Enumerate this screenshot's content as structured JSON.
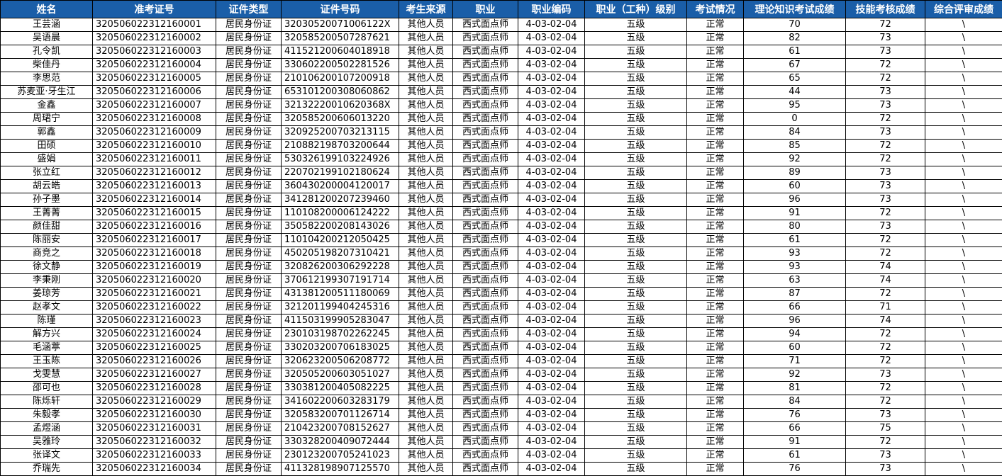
{
  "headers": [
    "姓名",
    "准考证号",
    "证件类型",
    "证件号码",
    "考生来源",
    "职业",
    "职业编码",
    "职业（工种）级别",
    "考试情况",
    "理论知识考试成绩",
    "技能考核成绩",
    "综合评审成绩"
  ],
  "rows": [
    [
      "王芸涵",
      "320506022312160001",
      "居民身份证",
      "32030520071006122X",
      "其他人员",
      "西式面点师",
      "4-03-02-04",
      "五级",
      "正常",
      "70",
      "72",
      "\\"
    ],
    [
      "吴语晨",
      "320506022312160002",
      "居民身份证",
      "320585200507287621",
      "其他人员",
      "西式面点师",
      "4-03-02-04",
      "五级",
      "正常",
      "82",
      "73",
      "\\"
    ],
    [
      "孔令凯",
      "320506022312160003",
      "居民身份证",
      "411521200604018918",
      "其他人员",
      "西式面点师",
      "4-03-02-04",
      "五级",
      "正常",
      "61",
      "73",
      "\\"
    ],
    [
      "柴佳丹",
      "320506022312160004",
      "居民身份证",
      "330602200502281526",
      "其他人员",
      "西式面点师",
      "4-03-02-04",
      "五级",
      "正常",
      "67",
      "72",
      "\\"
    ],
    [
      "李思范",
      "320506022312160005",
      "居民身份证",
      "210106200107200918",
      "其他人员",
      "西式面点师",
      "4-03-02-04",
      "五级",
      "正常",
      "65",
      "72",
      "\\"
    ],
    [
      "苏麦亚·牙生江",
      "320506022312160006",
      "居民身份证",
      "653101200308060862",
      "其他人员",
      "西式面点师",
      "4-03-02-04",
      "五级",
      "正常",
      "44",
      "73",
      "\\"
    ],
    [
      "金鑫",
      "320506022312160007",
      "居民身份证",
      "32132220010620368X",
      "其他人员",
      "西式面点师",
      "4-03-02-04",
      "五级",
      "正常",
      "95",
      "73",
      "\\"
    ],
    [
      "周珺宁",
      "320506022312160008",
      "居民身份证",
      "320585200606013220",
      "其他人员",
      "西式面点师",
      "4-03-02-04",
      "五级",
      "正常",
      "0",
      "72",
      "\\"
    ],
    [
      "郭鑫",
      "320506022312160009",
      "居民身份证",
      "320925200703213115",
      "其他人员",
      "西式面点师",
      "4-03-02-04",
      "五级",
      "正常",
      "84",
      "73",
      "\\"
    ],
    [
      "田硕",
      "320506022312160010",
      "居民身份证",
      "210882198703200644",
      "其他人员",
      "西式面点师",
      "4-03-02-04",
      "五级",
      "正常",
      "85",
      "72",
      "\\"
    ],
    [
      "盛娟",
      "320506022312160011",
      "居民身份证",
      "530326199103224926",
      "其他人员",
      "西式面点师",
      "4-03-02-04",
      "五级",
      "正常",
      "92",
      "72",
      "\\"
    ],
    [
      "张立红",
      "320506022312160012",
      "居民身份证",
      "220702199102180624",
      "其他人员",
      "西式面点师",
      "4-03-02-04",
      "五级",
      "正常",
      "89",
      "73",
      "\\"
    ],
    [
      "胡云皓",
      "320506022312160013",
      "居民身份证",
      "360430200004120017",
      "其他人员",
      "西式面点师",
      "4-03-02-04",
      "五级",
      "正常",
      "60",
      "73",
      "\\"
    ],
    [
      "孙子墨",
      "320506022312160014",
      "居民身份证",
      "341281200207239460",
      "其他人员",
      "西式面点师",
      "4-03-02-04",
      "五级",
      "正常",
      "96",
      "73",
      "\\"
    ],
    [
      "王菁菁",
      "320506022312160015",
      "居民身份证",
      "110108200006124222",
      "其他人员",
      "西式面点师",
      "4-03-02-04",
      "五级",
      "正常",
      "91",
      "72",
      "\\"
    ],
    [
      "颜佳甜",
      "320506022312160016",
      "居民身份证",
      "350582200208143026",
      "其他人员",
      "西式面点师",
      "4-03-02-04",
      "五级",
      "正常",
      "80",
      "73",
      "\\"
    ],
    [
      "陈丽安",
      "320506022312160017",
      "居民身份证",
      "110104200212050425",
      "其他人员",
      "西式面点师",
      "4-03-02-04",
      "五级",
      "正常",
      "61",
      "72",
      "\\"
    ],
    [
      "商竞之",
      "320506022312160018",
      "居民身份证",
      "450205198207310421",
      "其他人员",
      "西式面点师",
      "4-03-02-04",
      "五级",
      "正常",
      "93",
      "72",
      "\\"
    ],
    [
      "徐文静",
      "320506022312160019",
      "居民身份证",
      "320826200306292228",
      "其他人员",
      "西式面点师",
      "4-03-02-04",
      "五级",
      "正常",
      "93",
      "74",
      "\\"
    ],
    [
      "李秉刚",
      "320506022312160020",
      "居民身份证",
      "370612199307191714",
      "其他人员",
      "西式面点师",
      "4-03-02-04",
      "五级",
      "正常",
      "63",
      "74",
      "\\"
    ],
    [
      "姜琼芳",
      "320506022312160021",
      "居民身份证",
      "431381200511180069",
      "其他人员",
      "西式面点师",
      "4-03-02-04",
      "五级",
      "正常",
      "87",
      "72",
      "\\"
    ],
    [
      "赵孝文",
      "320506022312160022",
      "居民身份证",
      "321201199404245316",
      "其他人员",
      "西式面点师",
      "4-03-02-04",
      "五级",
      "正常",
      "66",
      "71",
      "\\"
    ],
    [
      "陈瑾",
      "320506022312160023",
      "居民身份证",
      "411503199905283047",
      "其他人员",
      "西式面点师",
      "4-03-02-04",
      "五级",
      "正常",
      "96",
      "74",
      "\\"
    ],
    [
      "解方兴",
      "320506022312160024",
      "居民身份证",
      "230103198702262245",
      "其他人员",
      "西式面点师",
      "4-03-02-04",
      "五级",
      "正常",
      "94",
      "72",
      "\\"
    ],
    [
      "毛涵葶",
      "320506022312160025",
      "居民身份证",
      "330203200706183025",
      "其他人员",
      "西式面点师",
      "4-03-02-04",
      "五级",
      "正常",
      "60",
      "72",
      "\\"
    ],
    [
      "王玉陈",
      "320506022312160026",
      "居民身份证",
      "320623200506208772",
      "其他人员",
      "西式面点师",
      "4-03-02-04",
      "五级",
      "正常",
      "71",
      "72",
      "\\"
    ],
    [
      "戈雯慧",
      "320506022312160027",
      "居民身份证",
      "320505200603051027",
      "其他人员",
      "西式面点师",
      "4-03-02-04",
      "五级",
      "正常",
      "92",
      "73",
      "\\"
    ],
    [
      "邵可也",
      "320506022312160028",
      "居民身份证",
      "330381200405082225",
      "其他人员",
      "西式面点师",
      "4-03-02-04",
      "五级",
      "正常",
      "81",
      "72",
      "\\"
    ],
    [
      "陈烁轩",
      "320506022312160029",
      "居民身份证",
      "341602200603283179",
      "其他人员",
      "西式面点师",
      "4-03-02-04",
      "五级",
      "正常",
      "84",
      "72",
      "\\"
    ],
    [
      "朱毅孝",
      "320506022312160030",
      "居民身份证",
      "320583200701126714",
      "其他人员",
      "西式面点师",
      "4-03-02-04",
      "五级",
      "正常",
      "76",
      "73",
      "\\"
    ],
    [
      "孟煜涵",
      "320506022312160031",
      "居民身份证",
      "210423200708152627",
      "其他人员",
      "西式面点师",
      "4-03-02-04",
      "五级",
      "正常",
      "66",
      "75",
      "\\"
    ],
    [
      "吴雅玲",
      "320506022312160032",
      "居民身份证",
      "330328200409072444",
      "其他人员",
      "西式面点师",
      "4-03-02-04",
      "五级",
      "正常",
      "91",
      "72",
      "\\"
    ],
    [
      "张译文",
      "320506022312160033",
      "居民身份证",
      "230123200705241023",
      "其他人员",
      "西式面点师",
      "4-03-02-04",
      "五级",
      "正常",
      "61",
      "73",
      "\\"
    ],
    [
      "乔瑞先",
      "320506022312160034",
      "居民身份证",
      "411328198907125570",
      "其他人员",
      "西式面点师",
      "4-03-02-04",
      "五级",
      "正常",
      "76",
      "73",
      "\\"
    ]
  ]
}
